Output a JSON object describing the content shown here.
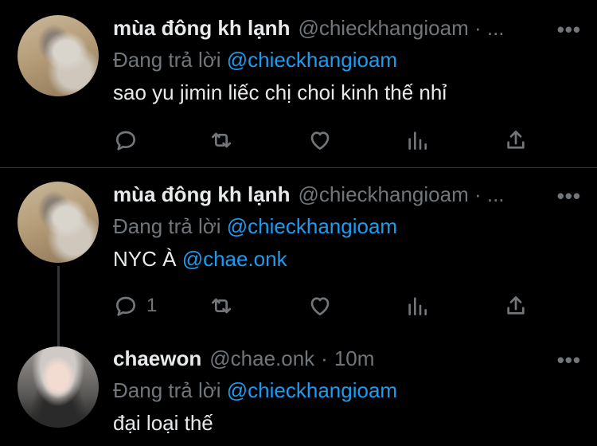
{
  "tweets": [
    {
      "name": "mùa đông kh lạnh",
      "handle": "@chieckhangioam · ...",
      "reply_label": "Đang trả lời ",
      "reply_to": "@chieckhangioam",
      "text": "sao yu jimin liếc chị choi kinh thế nhỉ",
      "more": "•••",
      "reply_count": "",
      "avatar": "cat-photo"
    },
    {
      "name": "mùa đông kh lạnh",
      "handle": "@chieckhangioam · ...",
      "reply_label": "Đang trả lời ",
      "reply_to": "@chieckhangioam",
      "text": "NYC À ",
      "mention": "@chae.onk",
      "more": "•••",
      "reply_count": "1",
      "avatar": "cat-photo"
    },
    {
      "name": "chaewon",
      "handle": "@chae.onk",
      "time": "10m",
      "reply_label": "Đang trả lời ",
      "reply_to": "@chieckhangioam",
      "text": "đại loại thế",
      "more": "•••",
      "avatar": "girl-photo"
    }
  ],
  "dot_separator": "·",
  "icons": [
    "reply-icon",
    "retweet-icon",
    "like-icon",
    "views-icon",
    "share-icon"
  ],
  "colors": {
    "background": "#000000",
    "text": "#e7e9ea",
    "muted": "#71767b",
    "link": "#1d9bf0"
  }
}
